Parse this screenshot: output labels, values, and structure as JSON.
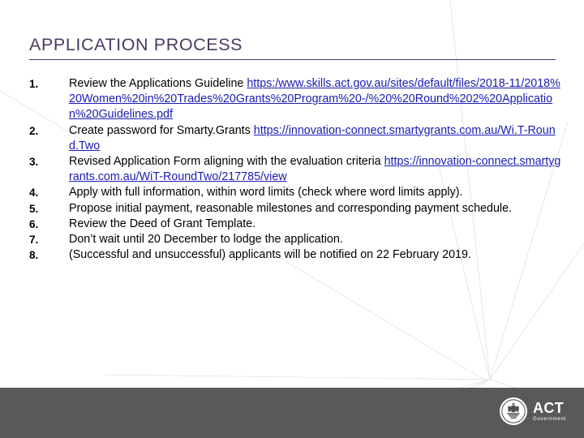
{
  "slide": {
    "title": "APPLICATION PROCESS",
    "accent_color": "#4B3B61",
    "link_color": "#1B1BB3",
    "footer_color": "#595959",
    "background_color": "#FFFFFF"
  },
  "items": [
    {
      "number": "1.",
      "text": "Review the Applications Guideline ",
      "link": "https:/www.skills.act.gov.au/sites/default/files/2018-11/2018%20Women%20in%20Trades%20Grants%20Program%20-/%20%20Round%202%20Application%20Guidelines.pdf"
    },
    {
      "number": "2.",
      "text": "Create password for Smarty.Grants ",
      "link": "https://innovation-connect.smartygrants.com.au/Wi.T-Round.Two"
    },
    {
      "number": "3.",
      "text": "Revised Application Form aligning with the evaluation criteria ",
      "link": "https://innovation-connect.smartygrants.com.au/WiT-RoundTwo/217785/view"
    },
    {
      "number": "4.",
      "text": "Apply with full information, within word limits (check where word limits apply).",
      "link": ""
    },
    {
      "number": "5.",
      "text": "Propose initial payment, reasonable milestones and corresponding payment schedule.",
      "link": ""
    },
    {
      "number": "6.",
      "text": "Review the Deed of Grant Template.",
      "link": ""
    },
    {
      "number": "7.",
      "text": "Don’t wait until 20 December to lodge the application.",
      "link": ""
    },
    {
      "number": "8.",
      "text": "(Successful and unsuccessful) applicants will be notified on 22 February 2019.",
      "link": ""
    }
  ],
  "footer": {
    "logo_primary": "ACT",
    "logo_secondary": "Government"
  }
}
